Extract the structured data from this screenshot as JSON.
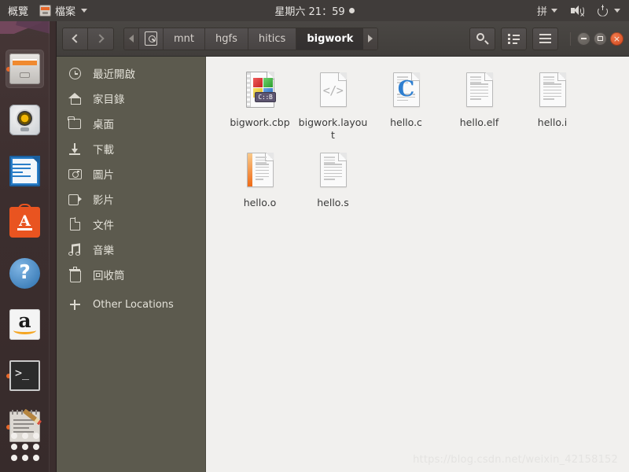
{
  "top_panel": {
    "overview_label": "概覽",
    "app_menu_label": "檔案",
    "app_menu_icon": "files-cabinet-icon",
    "clock": "星期六 21：59",
    "indicator_dot": "recording-indicator-icon",
    "ime_label": "拼",
    "volume_icon": "volume-muted-icon",
    "power_icon": "power-icon"
  },
  "launcher": {
    "items": [
      {
        "name": "files",
        "icon": "file-manager-icon",
        "active": true,
        "running": true
      },
      {
        "name": "rhythmbox",
        "icon": "music-player-icon",
        "active": false,
        "running": false
      },
      {
        "name": "libreoffice-writer",
        "icon": "writer-document-icon",
        "active": false,
        "running": false
      },
      {
        "name": "ubuntu-software",
        "icon": "software-center-icon",
        "active": false,
        "running": false
      },
      {
        "name": "help",
        "icon": "help-question-icon",
        "active": false,
        "running": false
      },
      {
        "name": "amazon",
        "icon": "amazon-icon",
        "active": false,
        "running": false
      },
      {
        "name": "terminal",
        "icon": "terminal-icon",
        "active": false,
        "running": true
      },
      {
        "name": "text-editor",
        "icon": "text-editor-icon",
        "active": false,
        "running": true
      }
    ],
    "app_grid_icon": "app-grid-icon"
  },
  "window": {
    "toolbar": {
      "back_icon": "chevron-left-icon",
      "forward_icon": "chevron-right-icon",
      "search_icon": "search-icon",
      "view_toggle_icon": "list-view-icon",
      "menu_icon": "hamburger-menu-icon",
      "minimize_label": "",
      "maximize_label": "",
      "close_label": "×"
    },
    "breadcrumb": {
      "scroll_left_icon": "triangle-left-icon",
      "scroll_right_icon": "triangle-right-icon",
      "device_icon": "disk-drive-icon",
      "crumbs": [
        {
          "label": "mnt",
          "active": false
        },
        {
          "label": "hgfs",
          "active": false
        },
        {
          "label": "hitics",
          "active": false
        },
        {
          "label": "bigwork",
          "active": true
        }
      ]
    },
    "sidebar": {
      "items": [
        {
          "label": "最近開啟",
          "icon": "clock-icon"
        },
        {
          "label": "家目錄",
          "icon": "home-icon"
        },
        {
          "label": "桌面",
          "icon": "folder-icon"
        },
        {
          "label": "下載",
          "icon": "download-icon"
        },
        {
          "label": "圖片",
          "icon": "camera-icon"
        },
        {
          "label": "影片",
          "icon": "video-icon"
        },
        {
          "label": "文件",
          "icon": "document-icon"
        },
        {
          "label": "音樂",
          "icon": "music-note-icon"
        },
        {
          "label": "回收筒",
          "icon": "trash-icon"
        },
        {
          "label": "Other Locations",
          "icon": "plus-icon"
        }
      ]
    },
    "files": [
      {
        "name": "bigwork.cbp",
        "icon": "codeblocks-project-icon",
        "selected": true,
        "badge": "C::B"
      },
      {
        "name": "bigwork.layout",
        "icon": "code-file-icon",
        "selected": false,
        "badge": "</>"
      },
      {
        "name": "hello.c",
        "icon": "c-source-icon",
        "selected": false,
        "badge": "C"
      },
      {
        "name": "hello.elf",
        "icon": "text-file-icon",
        "selected": false,
        "badge": ""
      },
      {
        "name": "hello.i",
        "icon": "text-file-icon",
        "selected": false,
        "badge": ""
      },
      {
        "name": "hello.o",
        "icon": "object-file-icon",
        "selected": false,
        "badge": ""
      },
      {
        "name": "hello.s",
        "icon": "text-file-icon",
        "selected": false,
        "badge": ""
      }
    ]
  },
  "watermark": "https://blog.csdn.net/weixin_42158152",
  "colors": {
    "panel_bg": "#403c3a",
    "launcher_bg": "#3c2e2e",
    "sidebar_bg": "#5c5a4e",
    "content_bg": "#f1f0ee",
    "titlebar_bg": "#453f3c",
    "accent_orange": "#e8682a",
    "close_button": "#e0532a",
    "crumb_active_bg": "#363230"
  }
}
